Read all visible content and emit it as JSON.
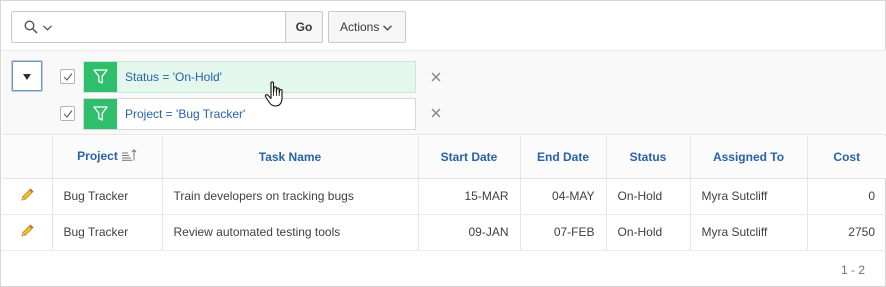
{
  "toolbar": {
    "search_icon": "search-icon",
    "search_value": "",
    "go_label": "Go",
    "actions_label": "Actions"
  },
  "filters": [
    {
      "label": "Status = 'On-Hold'",
      "checked": true,
      "active": true
    },
    {
      "label": "Project = 'Bug Tracker'",
      "checked": true,
      "active": false
    }
  ],
  "table": {
    "columns": [
      "",
      "Project",
      "Task Name",
      "Start Date",
      "End Date",
      "Status",
      "Assigned To",
      "Cost"
    ],
    "rows": [
      {
        "project": "Bug Tracker",
        "task": "Train developers on tracking bugs",
        "start": "15-MAR",
        "end": "04-MAY",
        "status": "On-Hold",
        "assigned": "Myra Sutcliff",
        "cost": "0"
      },
      {
        "project": "Bug Tracker",
        "task": "Review automated testing tools",
        "start": "09-JAN",
        "end": "07-FEB",
        "status": "On-Hold",
        "assigned": "Myra Sutcliff",
        "cost": "2750"
      }
    ]
  },
  "pagination": "1 - 2",
  "colors": {
    "filter_green": "#2fbf6c",
    "link_blue": "#2a61a8",
    "active_chip": "#e3f7ec"
  }
}
